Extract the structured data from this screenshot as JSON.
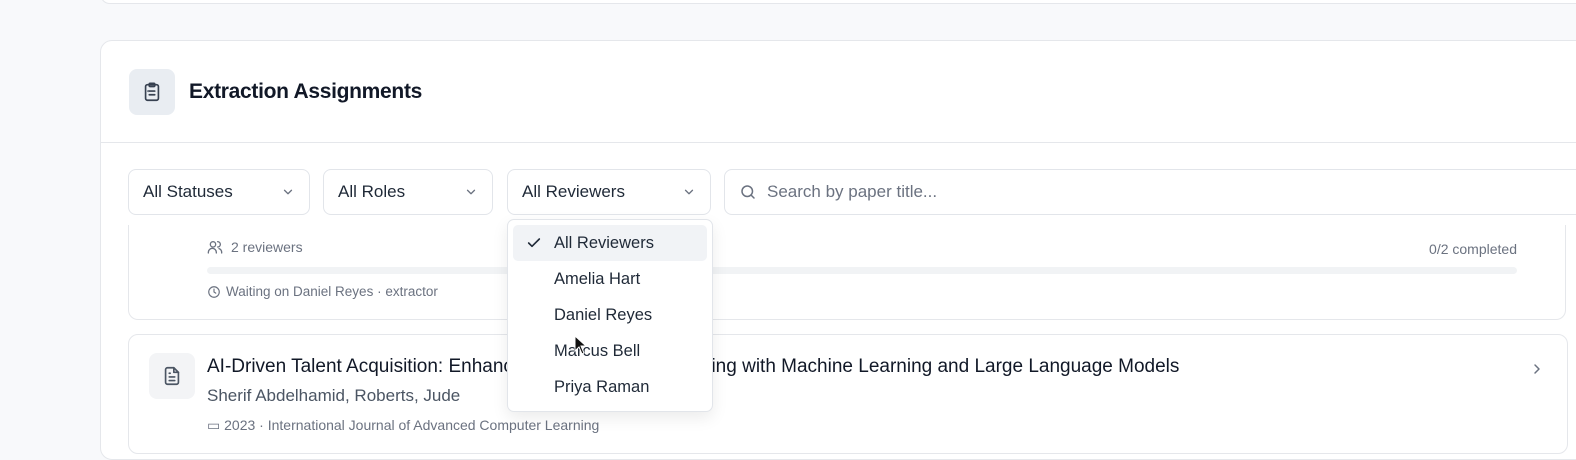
{
  "panel": {
    "title": "Extraction Assignments",
    "header_icon": "clipboard-icon"
  },
  "filters": {
    "status": {
      "value": "All Statuses"
    },
    "role": {
      "value": "All Roles"
    },
    "reviewer": {
      "value": "All Reviewers",
      "options": [
        "All Reviewers",
        "Amelia Hart",
        "Daniel Reyes",
        "Marcus Bell",
        "Priya Raman"
      ],
      "selected": "All Reviewers"
    },
    "search": {
      "placeholder": "Search by paper title...",
      "value": ""
    }
  },
  "papers": [
    {
      "reviewers": "2 reviewers",
      "completed": "0/2 completed",
      "progress": 0,
      "waiting": "Waiting on Daniel Reyes · extractor"
    },
    {
      "title": "AI-Driven Talent Acquisition: Enhancing Recruitment Screening with Machine Learning and Large Language Models",
      "authors": "Sherif Abdelhamid, Roberts, Jude",
      "meta_year": "2023",
      "meta_journal": "International Journal of Advanced Computer Learning"
    }
  ],
  "colors": {
    "background": "#f8f9fb",
    "border": "#e5e7eb",
    "muted_text": "#6b7280"
  }
}
